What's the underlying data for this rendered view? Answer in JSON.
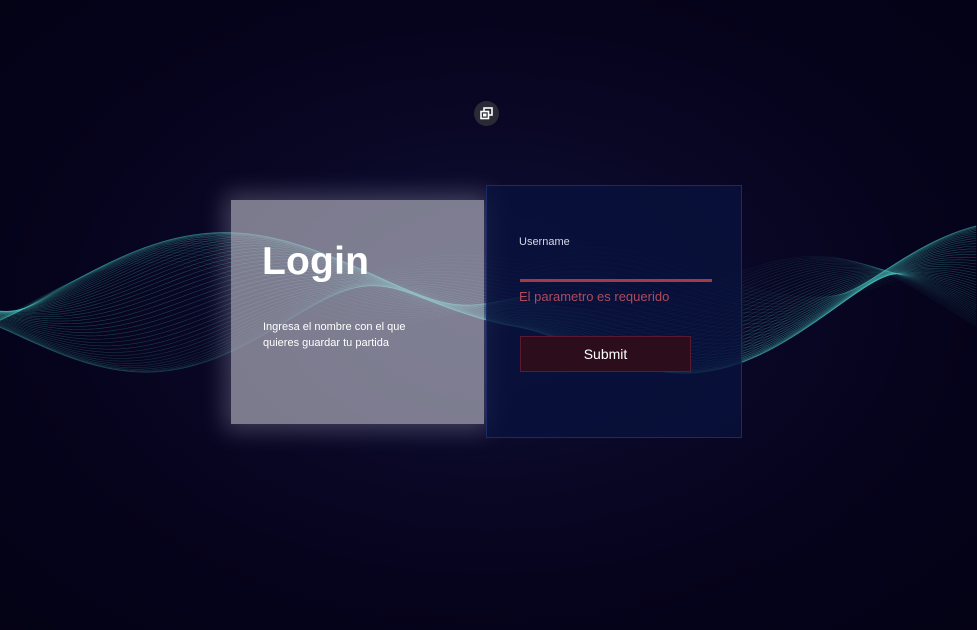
{
  "colors": {
    "background": "#07041a",
    "wave": "#4fd6cc",
    "left_panel": "#c4c4ce",
    "right_panel": "#08123e",
    "error": "#b04a5c",
    "input_underline": "#a33a48",
    "submit_bg": "#2c0d1c"
  },
  "icons": {
    "toggle": "window-restore-icon"
  },
  "login_panel": {
    "title": "Login",
    "description": "Ingresa el nombre con el que quieres guardar tu partida"
  },
  "form": {
    "username_label": "Username",
    "username_value": "",
    "error_message": "El parametro es requerido",
    "submit_label": "Submit"
  }
}
